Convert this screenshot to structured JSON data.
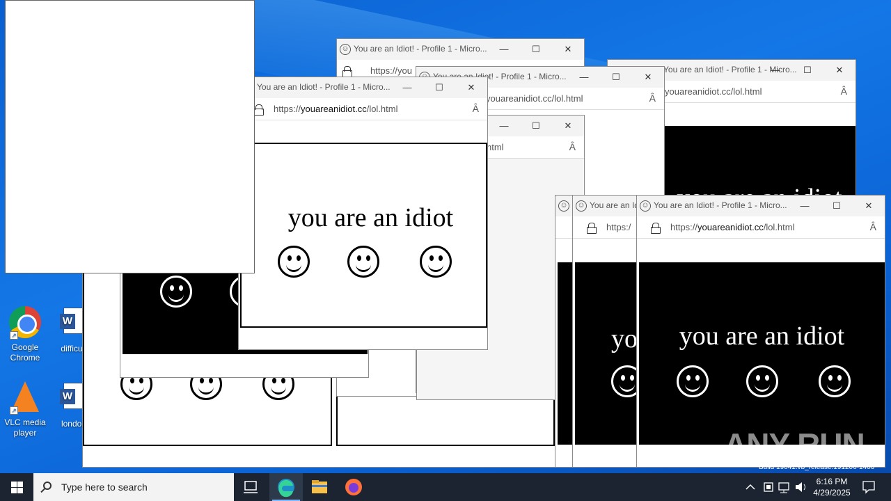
{
  "desktop": {
    "icons": [
      {
        "label_line1": "Google",
        "label_line2": "Chrome"
      },
      {
        "label_line1": "VLC media",
        "label_line2": "player"
      },
      {
        "label_line1": "difficult",
        "label_line2": ""
      },
      {
        "label_line1": "london",
        "label_line2": ""
      }
    ],
    "build_text": "Build 19041.vb_release.191206-1406",
    "watermark": "ANY RUN"
  },
  "windows": {
    "title": "You are an Idiot! - Profile 1 - Micro...",
    "title_short": "You are an Id",
    "url_prefix": "https://",
    "url_domain": "youareanidiot.cc",
    "url_path": "/lol.html",
    "url_partial_a": "https://you",
    "url_partial_b": "youareanidiot.cc/lol.html",
    "url_partial_c": "html",
    "url_partial_d": "https:/",
    "message": "you are an idiot",
    "message_partial": "yo",
    "message_top_clip": "vou are an idiot",
    "min_glyph": "—",
    "max_glyph": "☐",
    "close_glyph": "✕",
    "read_glyph": "Ȃ",
    "smile_glyph": "☺"
  },
  "taskbar": {
    "search_placeholder": "Type here to search",
    "time": "6:16 PM",
    "date": "4/29/2025"
  },
  "icons": [
    "windows-logo-icon",
    "search-icon",
    "task-view-icon",
    "edge-icon",
    "file-explorer-icon",
    "firefox-icon",
    "chevron-up-icon",
    "network-icon",
    "volume-icon",
    "notification-icon"
  ]
}
